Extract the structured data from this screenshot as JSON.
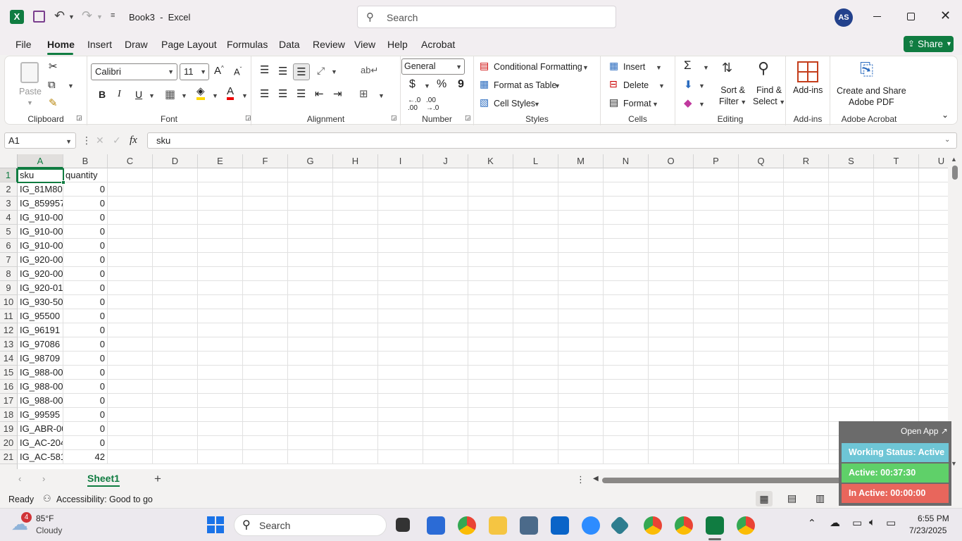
{
  "titlebar": {
    "doc_title": "Book3  -  Excel",
    "search_placeholder": "Search",
    "user_initials": "AS"
  },
  "menu": {
    "tabs": [
      "File",
      "Home",
      "Insert",
      "Draw",
      "Page Layout",
      "Formulas",
      "Data",
      "Review",
      "View",
      "Help",
      "Acrobat"
    ],
    "share": "Share"
  },
  "ribbon": {
    "clipboard": {
      "paste": "Paste",
      "label": "Clipboard"
    },
    "font": {
      "name": "Calibri",
      "size": "11",
      "bold": "B",
      "italic": "I",
      "underline": "U",
      "label": "Font"
    },
    "alignment": {
      "label": "Alignment"
    },
    "number": {
      "format": "General",
      "currency": "$",
      "percent": "%",
      "comma": "9",
      "label": "Number"
    },
    "styles": {
      "conditional": "Conditional Formatting",
      "format_table": "Format as Table",
      "cell_styles": "Cell Styles",
      "label": "Styles"
    },
    "cells": {
      "insert": "Insert",
      "delete": "Delete",
      "format": "Format",
      "label": "Cells"
    },
    "editing": {
      "sort": "Sort &",
      "filter": "Filter",
      "find": "Find &",
      "select": "Select",
      "label": "Editing"
    },
    "addins": {
      "button": "Add-ins",
      "label": "Add-ins"
    },
    "acrobat": {
      "line1": "Create and Share",
      "line2": "Adobe PDF",
      "label": "Adobe Acrobat"
    }
  },
  "formula_bar": {
    "name_box": "A1",
    "fx": "fx",
    "value": "sku"
  },
  "columns": [
    "A",
    "B",
    "C",
    "D",
    "E",
    "F",
    "G",
    "H",
    "I",
    "J",
    "K",
    "L",
    "M",
    "N",
    "O",
    "P",
    "Q",
    "R",
    "S",
    "T",
    "U"
  ],
  "rows": [
    {
      "n": "1",
      "a": "sku",
      "b": "quantity"
    },
    {
      "n": "2",
      "a": "IG_81M80",
      "b": "0"
    },
    {
      "n": "3",
      "a": "IG_859957",
      "b": "0"
    },
    {
      "n": "4",
      "a": "IG_910-00",
      "b": "0"
    },
    {
      "n": "5",
      "a": "IG_910-00",
      "b": "0"
    },
    {
      "n": "6",
      "a": "IG_910-00",
      "b": "0"
    },
    {
      "n": "7",
      "a": "IG_920-00",
      "b": "0"
    },
    {
      "n": "8",
      "a": "IG_920-00",
      "b": "0"
    },
    {
      "n": "9",
      "a": "IG_920-01",
      "b": "0"
    },
    {
      "n": "10",
      "a": "IG_930-50",
      "b": "0"
    },
    {
      "n": "11",
      "a": "IG_95500",
      "b": "0"
    },
    {
      "n": "12",
      "a": "IG_96191",
      "b": "0"
    },
    {
      "n": "13",
      "a": "IG_97086",
      "b": "0"
    },
    {
      "n": "14",
      "a": "IG_98709",
      "b": "0"
    },
    {
      "n": "15",
      "a": "IG_988-00",
      "b": "0"
    },
    {
      "n": "16",
      "a": "IG_988-00",
      "b": "0"
    },
    {
      "n": "17",
      "a": "IG_988-00",
      "b": "0"
    },
    {
      "n": "18",
      "a": "IG_99595",
      "b": "0"
    },
    {
      "n": "19",
      "a": "IG_ABR-00",
      "b": "0"
    },
    {
      "n": "20",
      "a": "IG_AC-204",
      "b": "0"
    },
    {
      "n": "21",
      "a": "IG_AC-581",
      "b": "42"
    }
  ],
  "sheets": {
    "active": "Sheet1",
    "add": "+"
  },
  "status": {
    "ready": "Ready",
    "accessibility": "Accessibility: Good to go"
  },
  "widget": {
    "open_app": "Open App",
    "working": "Working Status: Active",
    "active": "Active: 00:37:30",
    "inactive": "In Active: 00:00:00"
  },
  "taskbar": {
    "weather_temp": "85°F",
    "weather_desc": "Cloudy",
    "badge": "4",
    "search": "Search",
    "time": "6:55 PM",
    "date": "7/23/2025"
  }
}
